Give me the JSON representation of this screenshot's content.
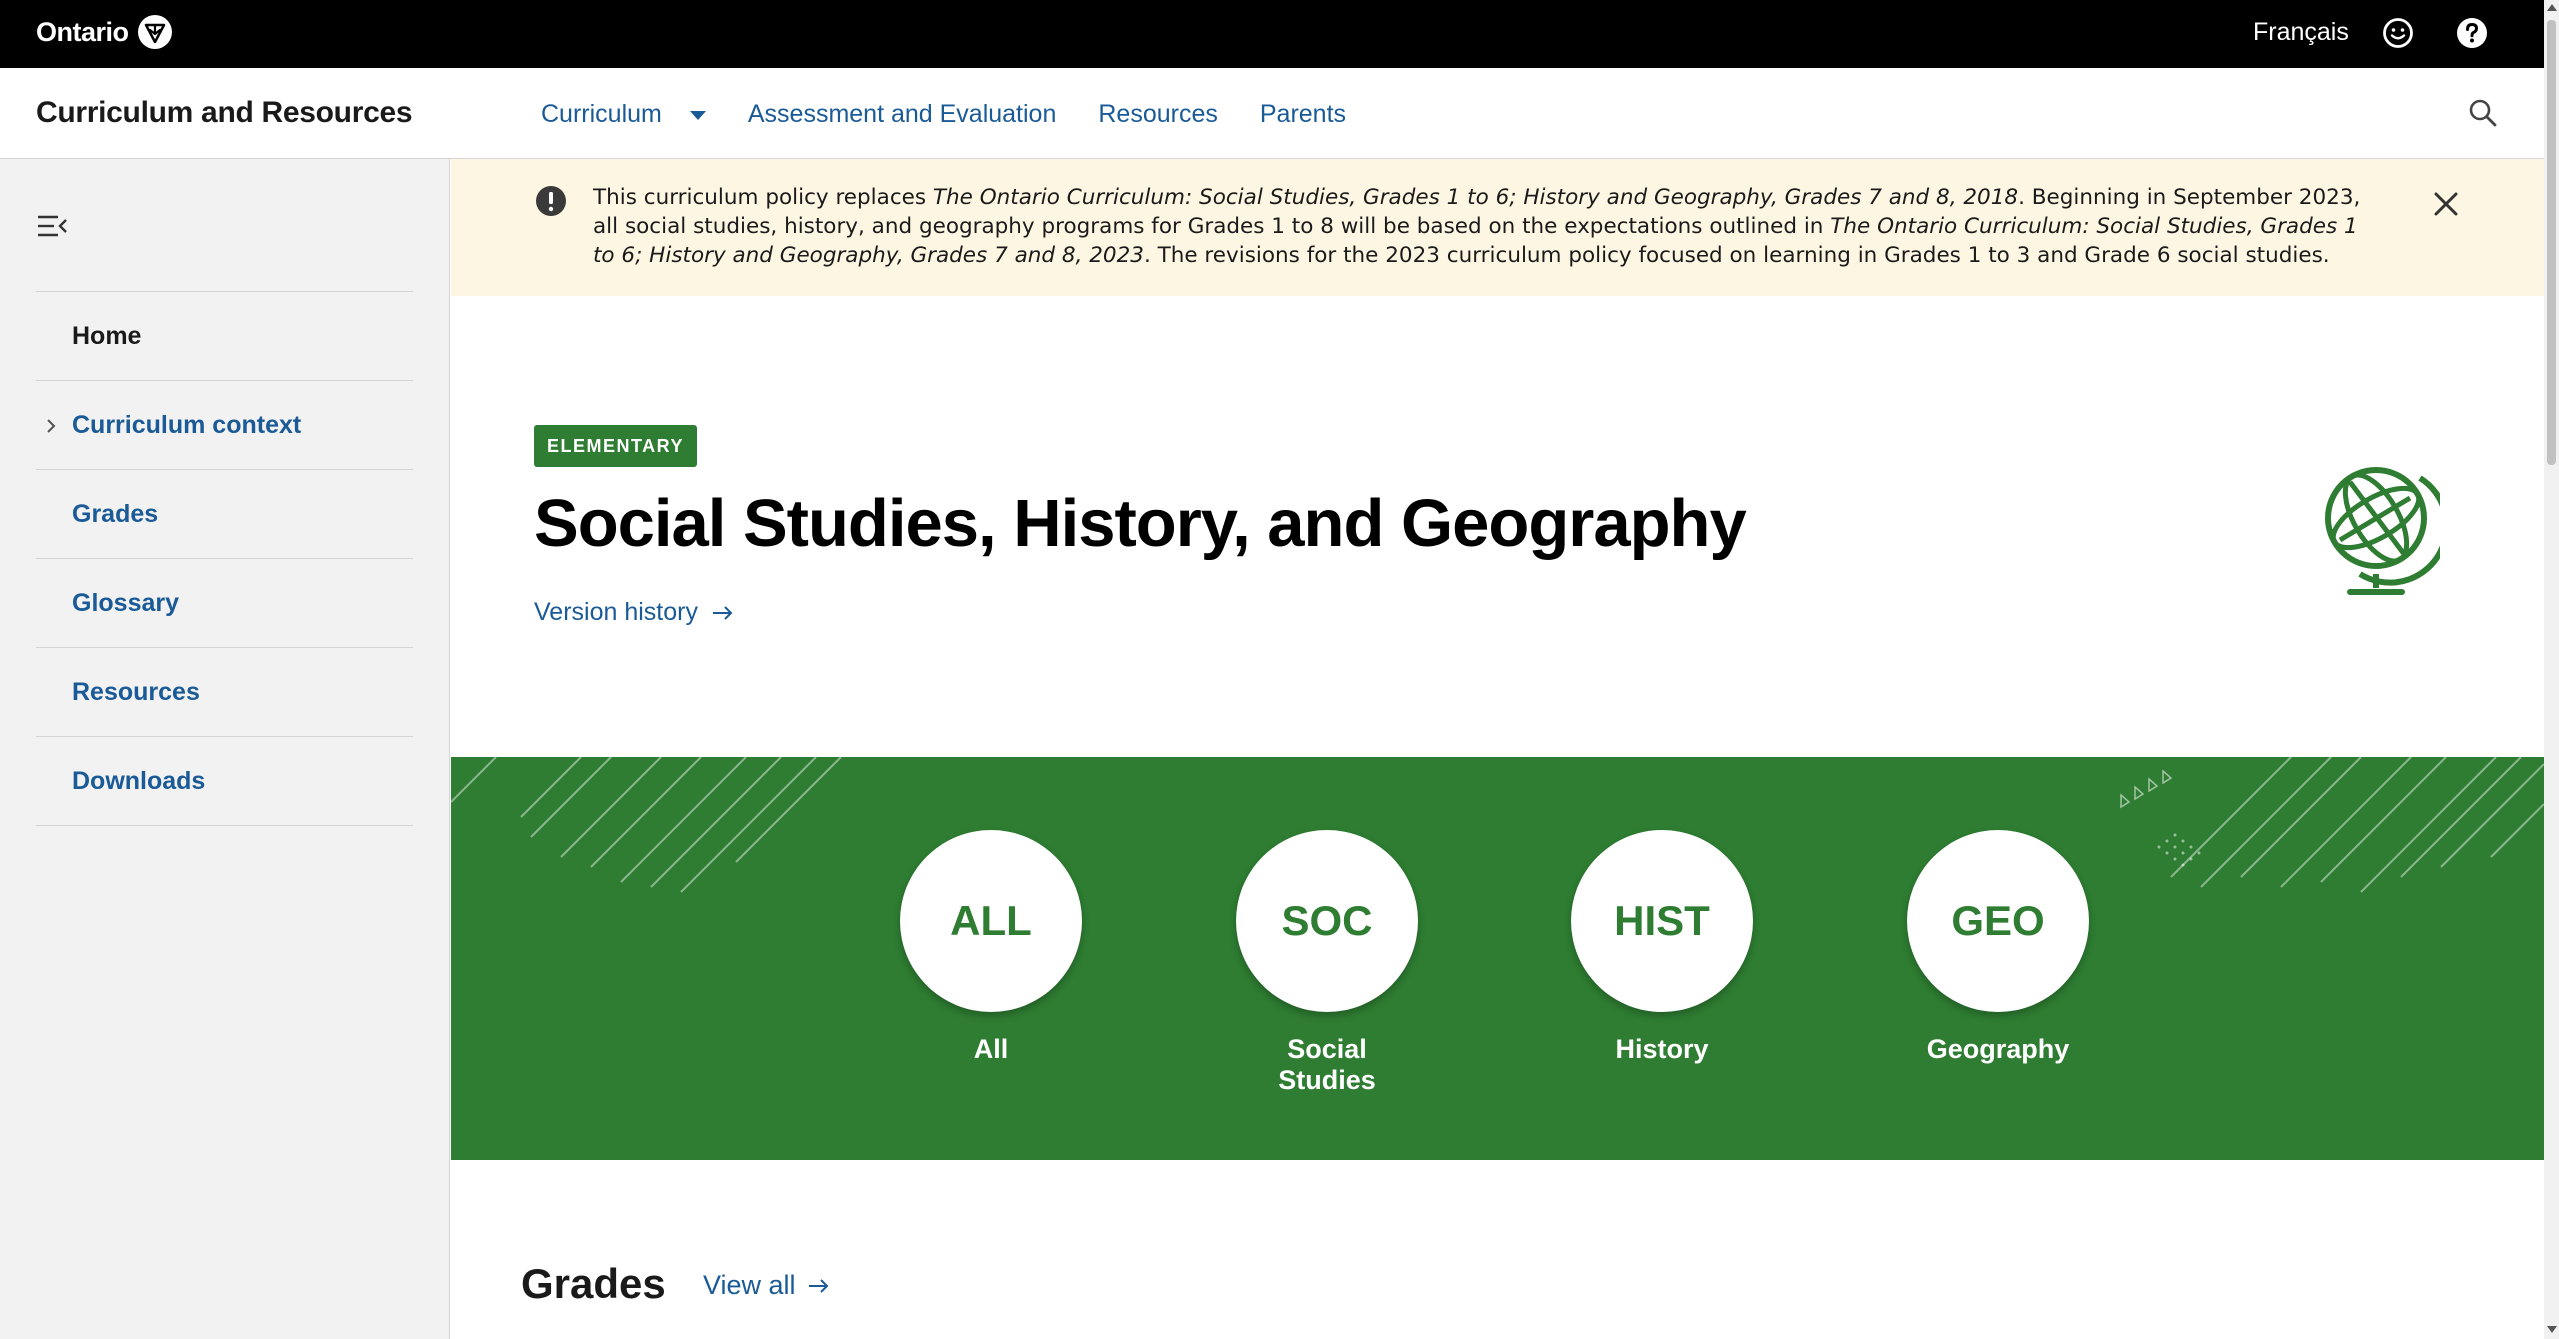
{
  "topbar": {
    "logo_text": "Ontario",
    "language_link": "Français",
    "icons": [
      "trillium-logo-icon",
      "feedback-smiley-icon",
      "help-question-icon"
    ]
  },
  "header": {
    "site_title": "Curriculum and Resources",
    "nav": [
      {
        "label": "Curriculum",
        "has_dropdown": true
      },
      {
        "label": "Assessment and Evaluation"
      },
      {
        "label": "Resources"
      },
      {
        "label": "Parents"
      }
    ],
    "search_icon": "search-icon"
  },
  "sidebar": {
    "collapse_icon": "menu-collapse-icon",
    "items": [
      {
        "label": "Home",
        "active": true
      },
      {
        "label": "Curriculum context",
        "expandable": true
      },
      {
        "label": "Grades"
      },
      {
        "label": "Glossary"
      },
      {
        "label": "Resources"
      },
      {
        "label": "Downloads"
      }
    ]
  },
  "banner": {
    "icon": "alert-exclamation-icon",
    "text_1": "This curriculum policy replaces ",
    "italic_1": "The Ontario Curriculum: Social Studies, Grades 1 to 6; History and Geography, Grades 7 and 8, 2018",
    "text_2": ". Beginning in September 2023, all social studies, history, and geography programs for Grades 1 to 8 will be based on the expectations outlined in ",
    "italic_2": "The Ontario Curriculum: Social Studies, Grades 1 to 6; History and Geography, Grades 7 and 8, 2023",
    "text_3": ". The revisions for the 2023 curriculum policy focused on learning in Grades 1 to 3 and Grade 6 social studies.",
    "close_icon": "close-icon"
  },
  "hero": {
    "badge": "ELEMENTARY",
    "title": "Social Studies, History, and Geography",
    "version_link": "Version history",
    "icon": "globe-icon"
  },
  "subjects": [
    {
      "abbr": "ALL",
      "label": "All"
    },
    {
      "abbr": "SOC",
      "label": "Social Studies"
    },
    {
      "abbr": "HIST",
      "label": "History"
    },
    {
      "abbr": "GEO",
      "label": "Geography"
    }
  ],
  "grades_section": {
    "heading": "Grades",
    "view_all": "View all"
  },
  "colors": {
    "brand_green": "#2e7d32",
    "link_blue": "#1a5a96",
    "banner_bg": "#fdf6e3",
    "sidebar_bg": "#f2f2f2"
  }
}
